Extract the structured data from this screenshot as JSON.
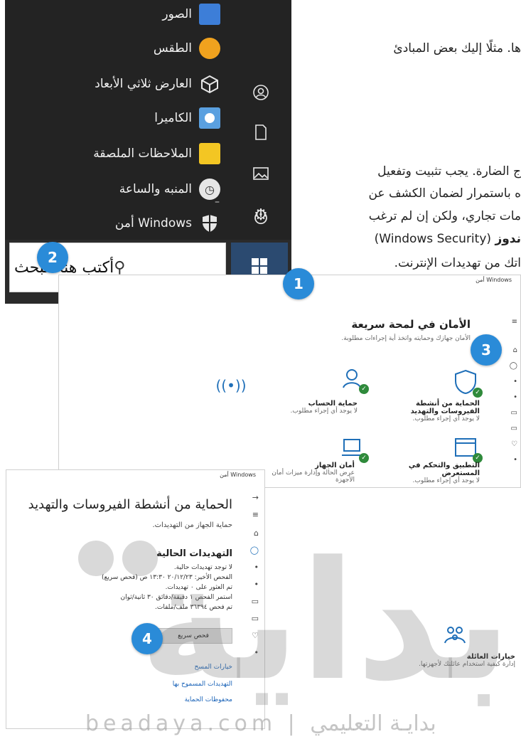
{
  "document": {
    "line1": "ها. مثلًا إليك بعض المبادئ",
    "line2": "ج الضارة. يجب تثبيت وتفعيل",
    "line3": "ه باستمرار لضمان الكشف عن",
    "line4": "مات تجاري، ولكن إن لم ترغب",
    "line5_bold": "ندوز",
    "line5_rest": "(Windows Security)",
    "line6": "اتك من تهديدات الإنترنت."
  },
  "start_menu": {
    "apps": [
      {
        "label": "الصور",
        "icon": "photos-tile-icon",
        "color": "#3d7ed8"
      },
      {
        "label": "الطقس",
        "icon": "weather-tile-icon",
        "color": "#f0a21e"
      },
      {
        "label": "العارض ثلاثي الأبعاد",
        "icon": "3d-viewer-icon",
        "color": "#e6e6e6"
      },
      {
        "label": "الكاميرا",
        "icon": "camera-tile-icon",
        "color": "#5aa0e0"
      },
      {
        "label": "الملاحظات الملصقة",
        "icon": "sticky-notes-tile-icon",
        "color": "#f3c623"
      },
      {
        "label": "المنبه والساعة",
        "icon": "alarms-clock-tile-icon",
        "color": "#5a5a5a"
      },
      {
        "label": "أمن Windows",
        "icon": "windows-security-shield-icon",
        "color": "#e6e6e6"
      }
    ],
    "rail_icons": [
      "user-icon",
      "document-icon",
      "pictures-icon",
      "settings-gear-icon",
      "power-icon"
    ]
  },
  "taskbar": {
    "search_placeholder": "أكتب هنا للبحث"
  },
  "callouts": {
    "one": "1",
    "two": "2",
    "three": "3",
    "four": "4"
  },
  "security_main": {
    "window_label": "أمن Windows",
    "title": "الأمان في لمحة سريعة",
    "subtitle": "الأمان جهازك وحمايته واتخذ أية إجراءات مطلوبة.",
    "tiles": [
      {
        "name": "الحماية من أنشطة الفيروسات والتهديد",
        "status": "لا يوجد أي إجراء مطلوب."
      },
      {
        "name": "حماية الحساب",
        "status": "لا يوجد أي إجراء مطلوب."
      },
      {
        "name": "التطبيق والتحكم في المستعرض",
        "status": "لا يوجد أي إجراء مطلوب."
      },
      {
        "name": "أمان الجهاز",
        "status": "عرض الحالة وإدارة ميزات أمان الأجهزة"
      },
      {
        "name": "خيارات العائلة",
        "status": "إدارة كيفية استخدام عائلتك لأجهزتها."
      }
    ]
  },
  "security_virus": {
    "window_label": "أمن Windows",
    "title": "الحماية من أنشطة الفيروسات والتهديد",
    "subtitle": "حماية الجهاز من التهديدات.",
    "heading": "التهديدات الحالية",
    "lines": [
      "لا توجد تهديدات حالية.",
      "الفحص الأخير: ٢٠/١٢/٢٣ ١٣:٣٠ ص (فحص سريع)",
      "تم العثور على ٠ تهديدات.",
      "استمر الفحص ١ دقيقة/دقائق ٣٠ ثانية/ثوان",
      "تم فحص ٣٦٣٩٤ ملف/ملفات."
    ],
    "scan_button": "فحص سريع",
    "links": [
      "خيارات المسح",
      "التهديدات المسموح بها",
      "محفوظات الحماية"
    ]
  },
  "watermark": {
    "letters": "بداية",
    "footer": "beadaya.com | بدايـة التعليمي"
  },
  "colors": {
    "start_bg": "#232323",
    "callout": "#2a8bd8",
    "check_green": "#2f8a3b",
    "link_blue": "#1a63b8"
  }
}
